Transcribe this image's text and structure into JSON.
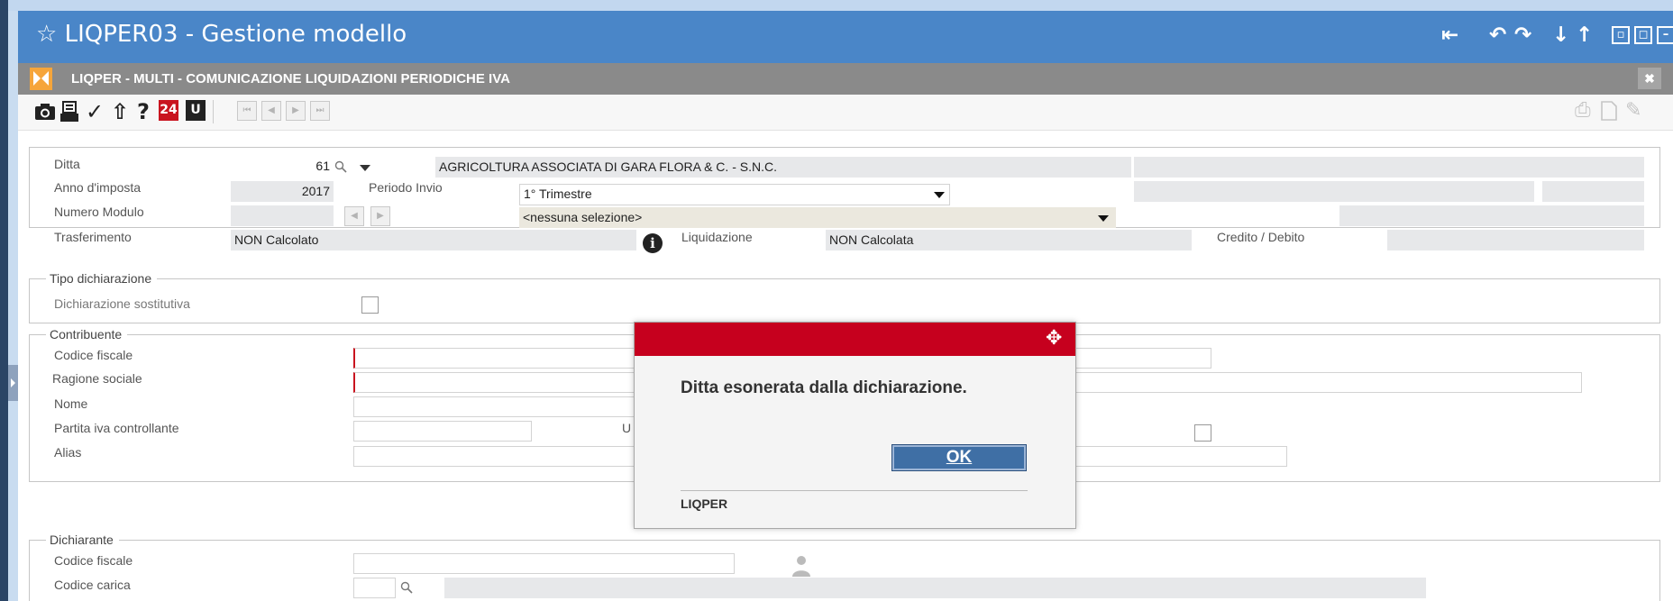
{
  "window": {
    "star_icon": "star-outline-icon",
    "title": "LIQPER03 - Gestione modello",
    "controls": [
      "first-page-icon",
      "undo-icon",
      "redo-icon",
      "arrow-down-icon",
      "arrow-up-icon",
      "restore-icon",
      "maximize-icon",
      "minimize-icon",
      "close-icon"
    ]
  },
  "subheader": {
    "title": "LIQPER  - MULTI -  COMUNICAZIONE LIQUIDAZIONI PERIODICHE IVA",
    "close_symbol": "✖"
  },
  "toolbar": {
    "items": [
      "camera-icon",
      "print-icon",
      "check-icon",
      "upload-icon",
      "help-icon",
      "calendar-24-icon",
      "user-calendar-icon"
    ],
    "badge_24": "24",
    "badge_u": "U",
    "help_symbol": "?",
    "check_symbol": "✓",
    "upload_symbol": "⇧",
    "nav": [
      "⏮",
      "◀",
      "▶",
      "⏭"
    ],
    "right_items": [
      "pdf-print-icon",
      "document-icon",
      "pencil-icon"
    ]
  },
  "header_form": {
    "ditta_label": "Ditta",
    "ditta_value": "61",
    "ditta_name": "AGRICOLTURA ASSOCIATA DI GARA FLORA &    C. - S.N.C.",
    "anno_label": "Anno d'imposta",
    "anno_value": "2017",
    "periodo_label": "Periodo Invio",
    "periodo_value": "1° Trimestre",
    "modulo_label": "Numero Modulo",
    "modulo_select": "<nessuna selezione>",
    "trasferimento_label": "Trasferimento",
    "trasferimento_value": "NON Calcolato",
    "liquidazione_label": "Liquidazione",
    "liquidazione_value": "NON Calcolata",
    "credito_label": "Credito / Debito"
  },
  "tipo_dichiarazione": {
    "legend": "Tipo dichiarazione",
    "sostitutiva_label": "Dichiarazione sostitutiva"
  },
  "contribuente": {
    "legend": "Contribuente",
    "codice_fiscale_label": "Codice fiscale",
    "ragione_sociale_label": "Ragione sociale",
    "nome_label": "Nome",
    "partita_iva_label": "Partita iva controllante",
    "alias_label": "Alias",
    "u_label": "U"
  },
  "dichiarante": {
    "legend": "Dichiarante",
    "codice_fiscale_label": "Codice fiscale",
    "codice_carica_label": "Codice carica"
  },
  "dialog": {
    "message": "Ditta esonerata dalla dichiarazione.",
    "ok_label": "OK",
    "footer": "LIQPER",
    "header_color": "#c6001e"
  },
  "colors": {
    "titlebar": "#4a86c8",
    "subbar": "#8a8a8a",
    "required_marker": "#c9141f"
  }
}
